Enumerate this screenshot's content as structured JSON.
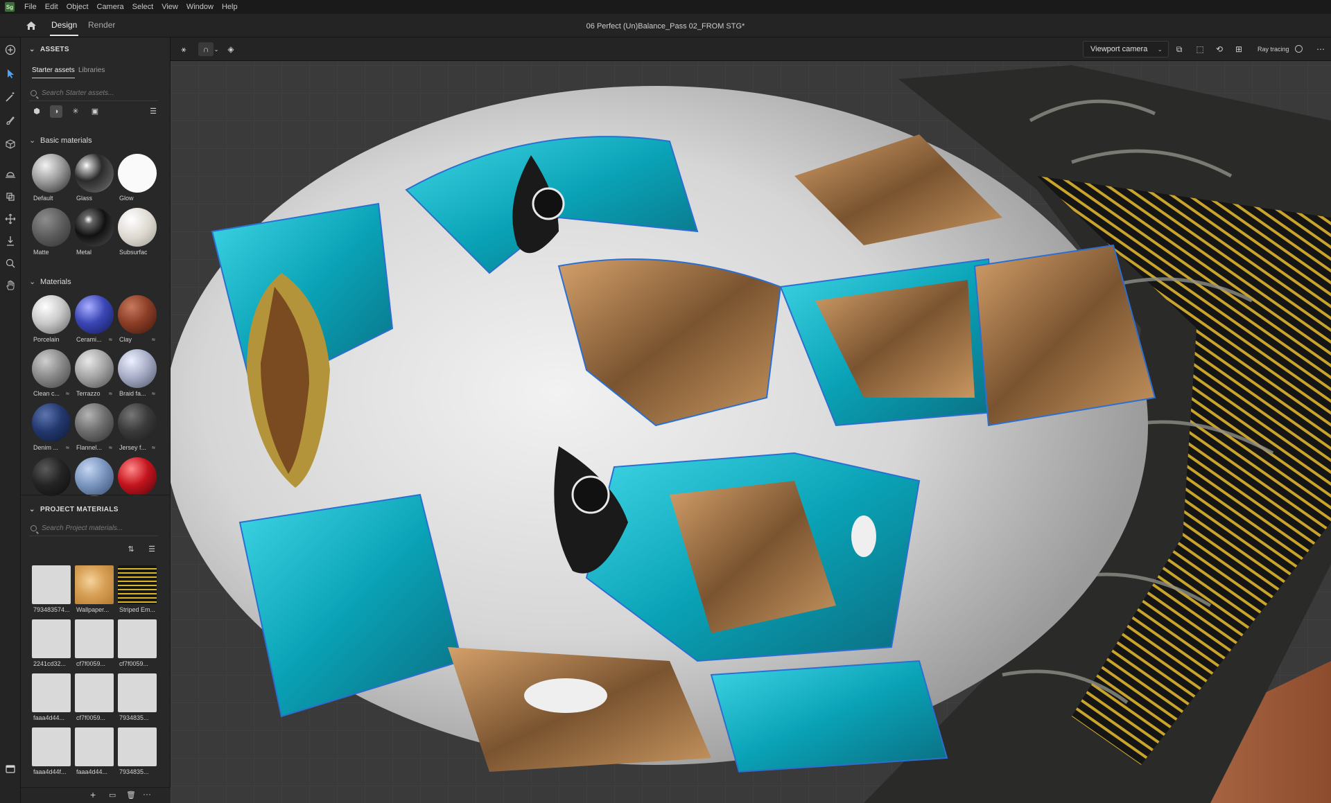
{
  "app": {
    "logo": "Sg",
    "menu": [
      "File",
      "Edit",
      "Object",
      "Camera",
      "Select",
      "View",
      "Window",
      "Help"
    ],
    "tabs": [
      "Design",
      "Render"
    ],
    "document_title": "06 Perfect (Un)Balance_Pass 02_FROM STG*"
  },
  "viewport": {
    "camera": "Viewport camera",
    "ray_tracing": "Ray tracing"
  },
  "assets": {
    "section_title": "ASSETS",
    "tabs": [
      "Starter assets",
      "Libraries"
    ],
    "search_placeholder": "Search Starter assets...",
    "basic_title": "Basic materials",
    "basic": [
      {
        "label": "Default"
      },
      {
        "label": "Glass"
      },
      {
        "label": "Glow"
      },
      {
        "label": "Matte"
      },
      {
        "label": "Metal"
      },
      {
        "label": "Subsurface"
      }
    ],
    "materials_title": "Materials",
    "materials": [
      {
        "label": "Porcelain"
      },
      {
        "label": "Cerami..."
      },
      {
        "label": "Clay"
      },
      {
        "label": "Clean c..."
      },
      {
        "label": "Terrazzo"
      },
      {
        "label": "Braid fa..."
      },
      {
        "label": "Denim ..."
      },
      {
        "label": "Flannel..."
      },
      {
        "label": "Jersey f..."
      },
      {
        "label": ""
      },
      {
        "label": ""
      },
      {
        "label": ""
      }
    ]
  },
  "project": {
    "section_title": "PROJECT MATERIALS",
    "search_placeholder": "Search Project materials...",
    "items": [
      {
        "label": "793483574..."
      },
      {
        "label": "Wallpaper..."
      },
      {
        "label": "Striped Em..."
      },
      {
        "label": "2241cd32..."
      },
      {
        "label": "cf7f0059..."
      },
      {
        "label": "cf7f0059..."
      },
      {
        "label": "faaa4d44..."
      },
      {
        "label": "cf7f0059..."
      },
      {
        "label": "7934835..."
      },
      {
        "label": "faaa4d44f..."
      },
      {
        "label": "faaa4d44..."
      },
      {
        "label": "7934835..."
      }
    ]
  }
}
